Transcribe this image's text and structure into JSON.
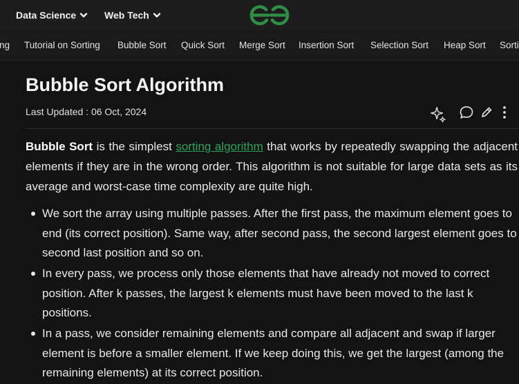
{
  "topnav": {
    "items": [
      {
        "label": "Data Science"
      },
      {
        "label": "Web Tech"
      }
    ],
    "logo_color": "#2f8d46"
  },
  "tabs": [
    {
      "label": "ng"
    },
    {
      "label": "Tutorial on Sorting"
    },
    {
      "label": "Bubble Sort"
    },
    {
      "label": "Quick Sort"
    },
    {
      "label": "Merge Sort"
    },
    {
      "label": "Insertion Sort"
    },
    {
      "label": "Selection Sort"
    },
    {
      "label": "Heap Sort"
    },
    {
      "label": "Sorti"
    }
  ],
  "article": {
    "title": "Bubble Sort Algorithm",
    "last_updated": "Last Updated : 06 Oct, 2024",
    "intro": {
      "bold": "Bubble Sort",
      "before_link": " is the simplest ",
      "link": "sorting algorithm",
      "after_link": " that works by repeatedly swapping the adjacent elements if they are in the wrong order. This algorithm is not suitable for large data sets as its average and worst-case time complexity are quite high."
    },
    "bullets": [
      "We sort the array using multiple passes. After the first pass, the maximum element goes to end (its correct position). Same way, after second pass, the second largest element goes to second last position and so on.",
      "In every pass, we process only those elements that have already not moved to correct position. After k passes, the largest k elements must have been moved to the last k positions.",
      "In a pass, we consider remaining elements and compare all adjacent and swap if larger element is before a smaller element. If we keep doing this, we get the largest (among the remaining elements) at its correct position."
    ]
  },
  "colors": {
    "accent": "#2fa35a",
    "background": "#131313"
  }
}
